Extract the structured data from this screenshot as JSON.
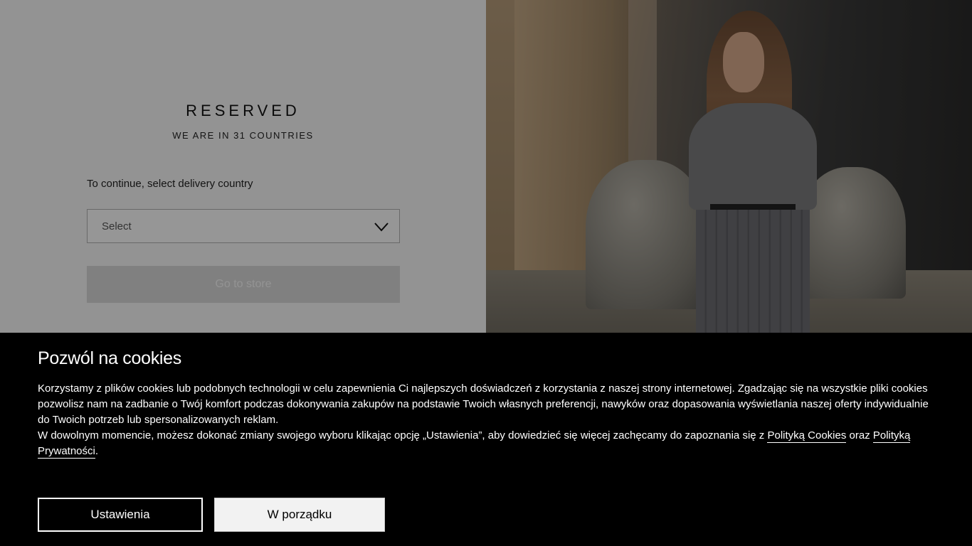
{
  "brand": {
    "logo": "RESERVED",
    "tagline": "WE ARE IN 31 COUNTRIES"
  },
  "country": {
    "prompt": "To continue, select delivery country",
    "select_placeholder": "Select",
    "go_button": "Go to store"
  },
  "cookies": {
    "title": "Pozwól na cookies",
    "paragraph1": "Korzystamy z plików cookies lub podobnych technologii w celu zapewnienia Ci najlepszych doświadczeń z korzystania z naszej strony internetowej. Zgadzając się na wszystkie pliki cookies pozwolisz nam na zadbanie o Twój komfort podczas dokonywania zakupów na podstawie Twoich własnych preferencji, nawyków oraz dopasowania wyświetlania naszej oferty indywidualnie do Twoich potrzeb lub spersonalizowanych reklam.",
    "paragraph2_prefix": "W dowolnym momencie, możesz dokonać zmiany swojego wyboru klikając opcję „Ustawienia”, aby dowiedzieć się więcej zachęcamy do zapoznania się z ",
    "link_cookies": "Polityką Cookies",
    "connector": " oraz ",
    "link_privacy": "Polityką Prywatności",
    "end": ".",
    "settings_button": "Ustawienia",
    "ok_button": "W porządku"
  },
  "colors": {
    "overlay": "rgba(0,0,0,0.4)",
    "banner_bg": "#000000",
    "ok_bg": "#f2f2f2"
  }
}
